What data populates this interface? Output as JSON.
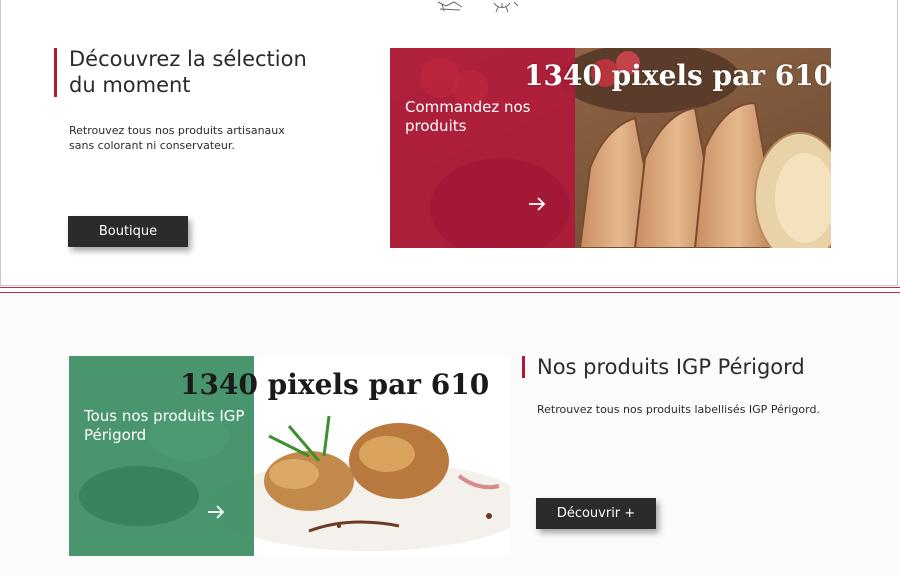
{
  "promo": {
    "heading": "Découvrez la sélection du moment",
    "description": "Retrouvez tous nos produits artisanaux sans colorant ni conservateur.",
    "button_label": "Boutique",
    "card": {
      "label": "Commandez nos produits",
      "watermark": "1340 pixels par 610",
      "overlay_color": "#b0183a",
      "icon": "arrow-right-icon"
    }
  },
  "igp": {
    "heading": "Nos produits IGP Périgord",
    "description": "Retrouvez tous nos produits labellisés IGP Périgord.",
    "button_label": "Découvrir +",
    "card": {
      "label": "Tous nos produits IGP Périgord",
      "watermark": "1340 pixels par 610",
      "overlay_color": "#3a8d63",
      "icon": "arrow-right-icon"
    }
  },
  "colors": {
    "accent_red": "#b0183a",
    "button_dark": "#2b2b2b",
    "separator_red": "#c8283c"
  }
}
